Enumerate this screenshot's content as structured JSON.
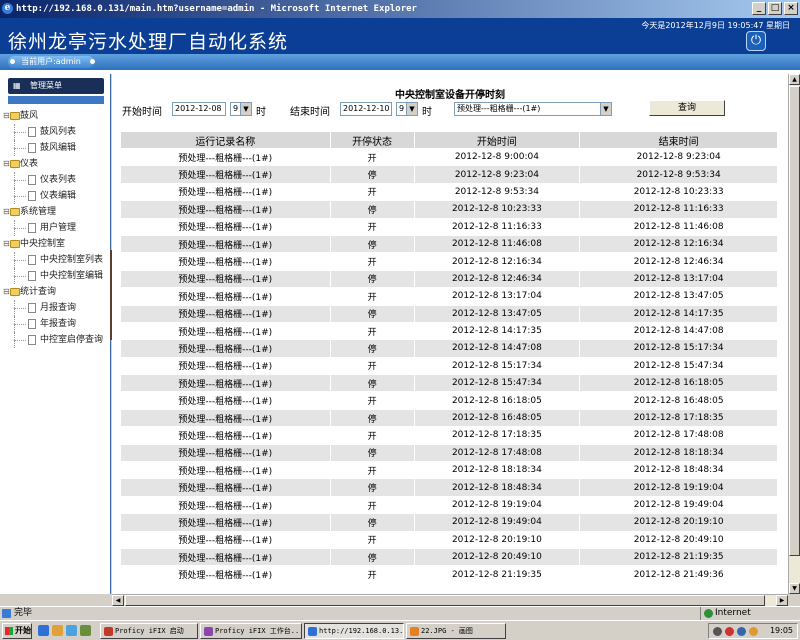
{
  "browser": {
    "title": "http://192.168.0.131/main.htm?username=admin - Microsoft Internet Explorer",
    "status": "完毕",
    "zone": "Internet"
  },
  "app": {
    "title": "徐州龙亭污水处理厂自动化系统",
    "datetime": "今天是2012年12月9日 19:05:47 星期日",
    "current_user": "当前用户:admin"
  },
  "sidebar": {
    "menu_title": "管理菜单",
    "groups": [
      {
        "label": "鼓风",
        "items": [
          "鼓风列表",
          "鼓风编辑"
        ]
      },
      {
        "label": "仪表",
        "items": [
          "仪表列表",
          "仪表编辑"
        ]
      },
      {
        "label": "系统管理",
        "items": [
          "用户管理"
        ]
      },
      {
        "label": "中央控制室",
        "items": [
          "中央控制室列表",
          "中央控制室编辑"
        ]
      },
      {
        "label": "统计查询",
        "items": [
          "月报查询",
          "年报查询",
          "中控室启停查询"
        ]
      }
    ]
  },
  "main": {
    "title": "中央控制室设备开停时刻",
    "filters": {
      "start_label": "开始时间",
      "start_date": "2012-12-08",
      "start_hour": "9",
      "end_label": "结束时间",
      "end_date": "2012-12-10",
      "end_hour": "9",
      "hour_unit": "时",
      "device": "预处理---粗格栅---(1#)",
      "query_button": "查询"
    },
    "table": {
      "headers": [
        "运行记录名称",
        "开停状态",
        "开始时间",
        "结束时间"
      ],
      "rows": [
        [
          "预处理---粗格栅---(1#)",
          "开",
          "2012-12-8 9:00:04",
          "2012-12-8 9:23:04"
        ],
        [
          "预处理---粗格栅---(1#)",
          "停",
          "2012-12-8 9:23:04",
          "2012-12-8 9:53:34"
        ],
        [
          "预处理---粗格栅---(1#)",
          "开",
          "2012-12-8 9:53:34",
          "2012-12-8 10:23:33"
        ],
        [
          "预处理---粗格栅---(1#)",
          "停",
          "2012-12-8 10:23:33",
          "2012-12-8 11:16:33"
        ],
        [
          "预处理---粗格栅---(1#)",
          "开",
          "2012-12-8 11:16:33",
          "2012-12-8 11:46:08"
        ],
        [
          "预处理---粗格栅---(1#)",
          "停",
          "2012-12-8 11:46:08",
          "2012-12-8 12:16:34"
        ],
        [
          "预处理---粗格栅---(1#)",
          "开",
          "2012-12-8 12:16:34",
          "2012-12-8 12:46:34"
        ],
        [
          "预处理---粗格栅---(1#)",
          "停",
          "2012-12-8 12:46:34",
          "2012-12-8 13:17:04"
        ],
        [
          "预处理---粗格栅---(1#)",
          "开",
          "2012-12-8 13:17:04",
          "2012-12-8 13:47:05"
        ],
        [
          "预处理---粗格栅---(1#)",
          "停",
          "2012-12-8 13:47:05",
          "2012-12-8 14:17:35"
        ],
        [
          "预处理---粗格栅---(1#)",
          "开",
          "2012-12-8 14:17:35",
          "2012-12-8 14:47:08"
        ],
        [
          "预处理---粗格栅---(1#)",
          "停",
          "2012-12-8 14:47:08",
          "2012-12-8 15:17:34"
        ],
        [
          "预处理---粗格栅---(1#)",
          "开",
          "2012-12-8 15:17:34",
          "2012-12-8 15:47:34"
        ],
        [
          "预处理---粗格栅---(1#)",
          "停",
          "2012-12-8 15:47:34",
          "2012-12-8 16:18:05"
        ],
        [
          "预处理---粗格栅---(1#)",
          "开",
          "2012-12-8 16:18:05",
          "2012-12-8 16:48:05"
        ],
        [
          "预处理---粗格栅---(1#)",
          "停",
          "2012-12-8 16:48:05",
          "2012-12-8 17:18:35"
        ],
        [
          "预处理---粗格栅---(1#)",
          "开",
          "2012-12-8 17:18:35",
          "2012-12-8 17:48:08"
        ],
        [
          "预处理---粗格栅---(1#)",
          "停",
          "2012-12-8 17:48:08",
          "2012-12-8 18:18:34"
        ],
        [
          "预处理---粗格栅---(1#)",
          "开",
          "2012-12-8 18:18:34",
          "2012-12-8 18:48:34"
        ],
        [
          "预处理---粗格栅---(1#)",
          "停",
          "2012-12-8 18:48:34",
          "2012-12-8 19:19:04"
        ],
        [
          "预处理---粗格栅---(1#)",
          "开",
          "2012-12-8 19:19:04",
          "2012-12-8 19:49:04"
        ],
        [
          "预处理---粗格栅---(1#)",
          "停",
          "2012-12-8 19:49:04",
          "2012-12-8 20:19:10"
        ],
        [
          "预处理---粗格栅---(1#)",
          "开",
          "2012-12-8 20:19:10",
          "2012-12-8 20:49:10"
        ],
        [
          "预处理---粗格栅---(1#)",
          "停",
          "2012-12-8 20:49:10",
          "2012-12-8 21:19:35"
        ],
        [
          "预处理---粗格栅---(1#)",
          "开",
          "2012-12-8 21:19:35",
          "2012-12-8 21:49:36"
        ]
      ]
    }
  },
  "taskbar": {
    "start": "开始",
    "tasks": [
      {
        "label": "Proficy iFIX 启动",
        "icon": "ifix-icon",
        "color": "#c0392b",
        "active": false
      },
      {
        "label": "Proficy iFIX 工作台...",
        "icon": "ifix-workspace-icon",
        "color": "#8e44ad",
        "active": false
      },
      {
        "label": "http://192.168.0.13...",
        "icon": "ie-icon",
        "color": "#2e6fd8",
        "active": true
      },
      {
        "label": "22.JPG - 画图",
        "icon": "paint-icon",
        "color": "#e67e22",
        "active": false
      }
    ],
    "clock": "19:05"
  },
  "colors": {
    "header_blue": "#0b3f95",
    "menu_dark": "#1a2f57",
    "row_alt": "#e4e4e4"
  }
}
